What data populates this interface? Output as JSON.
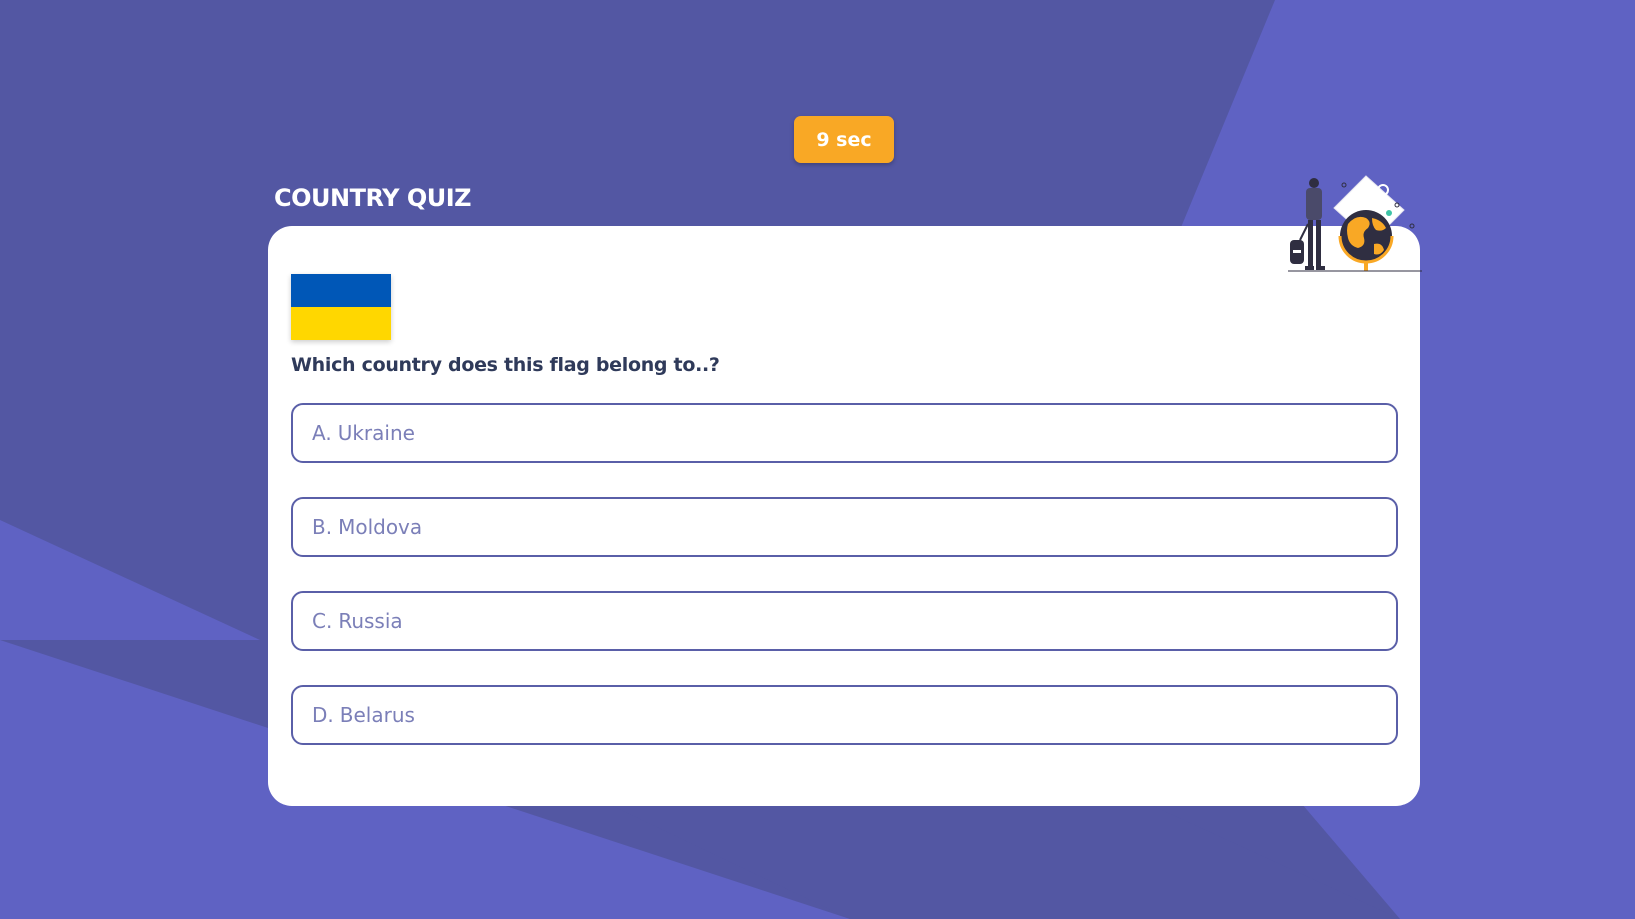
{
  "timer": {
    "label": "9 sec"
  },
  "quiz": {
    "title": "COUNTRY QUIZ",
    "question": "Which country does this flag belong to..?",
    "flag": {
      "name": "ukraine-flag",
      "colors": [
        "#0057b7",
        "#ffd700"
      ]
    },
    "illustration_icon": "traveler-with-globe-icon",
    "options": [
      {
        "letter": "A.",
        "text": "Ukraine"
      },
      {
        "letter": "B.",
        "text": "Moldova"
      },
      {
        "letter": "C.",
        "text": "Russia"
      },
      {
        "letter": "D.",
        "text": "Belarus"
      }
    ]
  },
  "colors": {
    "background": "#5f62c3",
    "background_dark": "#5357a3",
    "timer": "#f9a825",
    "card": "#ffffff",
    "option_border": "#5a5fa8",
    "option_text": "#7b7fb8",
    "question_text": "#2f3a5a"
  }
}
